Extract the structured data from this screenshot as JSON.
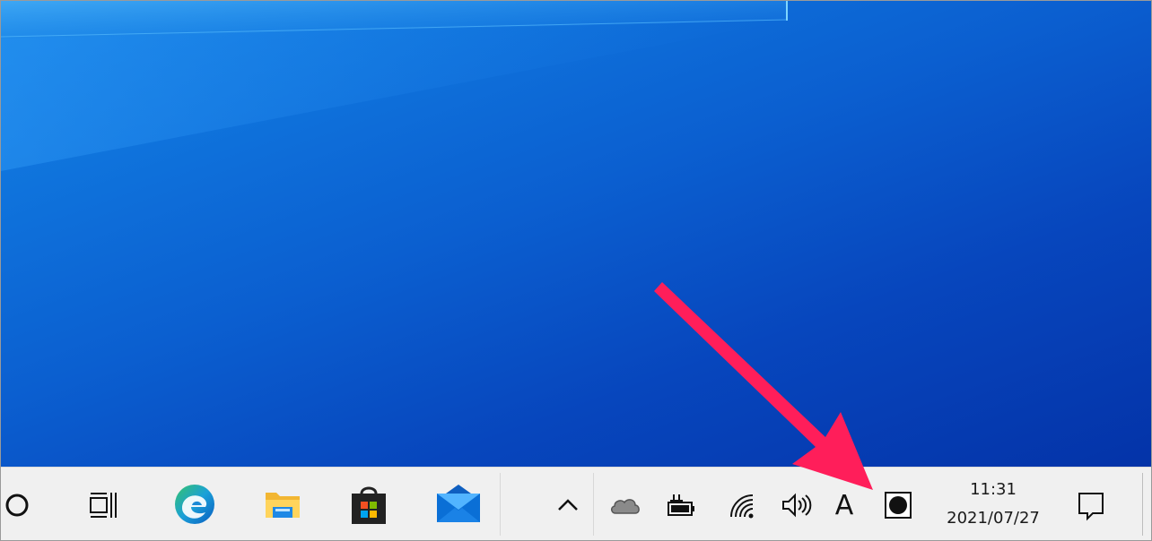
{
  "desktop": {
    "background_color": "#0b5fd0"
  },
  "taskbar": {
    "pinned": [
      {
        "name": "search-icon"
      },
      {
        "name": "task-view-icon"
      },
      {
        "name": "edge-icon"
      },
      {
        "name": "file-explorer-icon"
      },
      {
        "name": "microsoft-store-icon"
      },
      {
        "name": "mail-icon"
      }
    ],
    "tray": {
      "overflow_icon": "chevron-up-icon",
      "icons": [
        "onedrive-icon",
        "battery-icon",
        "wifi-icon",
        "volume-icon",
        "ime-icon",
        "night-light-icon"
      ],
      "ime_label": "A"
    },
    "clock": {
      "time": "11:31",
      "date": "2021/07/27"
    },
    "notification_icon": "action-center-icon"
  },
  "annotation": {
    "arrow_color": "#ff1e5a"
  }
}
